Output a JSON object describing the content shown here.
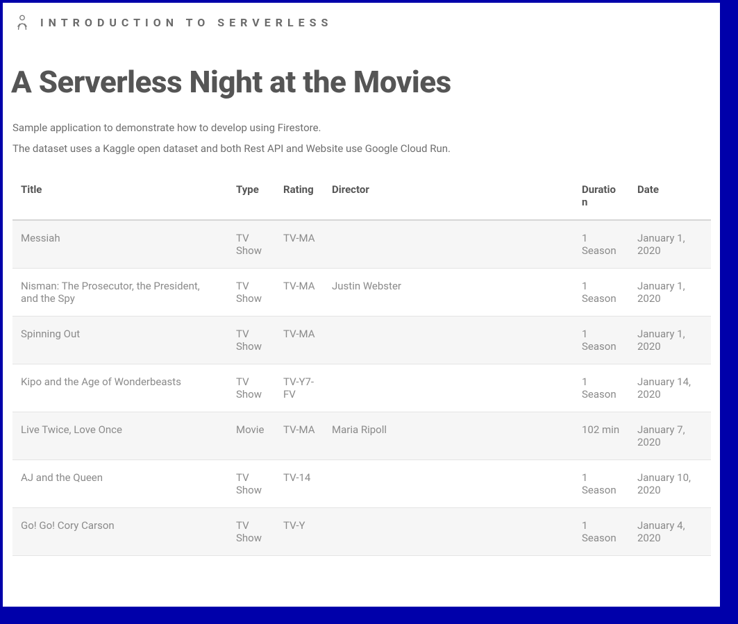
{
  "header": {
    "site_title": "INTRODUCTION TO SERVERLESS"
  },
  "main": {
    "page_title": "A Serverless Night at the Movies",
    "desc_line1": "Sample application to demonstrate how to develop using Firestore.",
    "desc_line2": "The dataset uses a Kaggle open dataset and both Rest API and Website use Google Cloud Run."
  },
  "table": {
    "headers": {
      "title": "Title",
      "type": "Type",
      "rating": "Rating",
      "director": "Director",
      "duration": "Duration",
      "date": "Date"
    },
    "rows": [
      {
        "title": "Messiah",
        "type": "TV Show",
        "rating": "TV-MA",
        "director": "",
        "duration": "1 Season",
        "date": "January 1, 2020"
      },
      {
        "title": "Nisman: The Prosecutor, the President, and the Spy",
        "type": "TV Show",
        "rating": "TV-MA",
        "director": "Justin Webster",
        "duration": "1 Season",
        "date": "January 1, 2020"
      },
      {
        "title": "Spinning Out",
        "type": "TV Show",
        "rating": "TV-MA",
        "director": "",
        "duration": "1 Season",
        "date": "January 1, 2020"
      },
      {
        "title": "Kipo and the Age of Wonderbeasts",
        "type": "TV Show",
        "rating": "TV-Y7-FV",
        "director": "",
        "duration": "1 Season",
        "date": "January 14, 2020"
      },
      {
        "title": "Live Twice, Love Once",
        "type": "Movie",
        "rating": "TV-MA",
        "director": "Maria Ripoll",
        "duration": "102 min",
        "date": "January 7, 2020"
      },
      {
        "title": "AJ and the Queen",
        "type": "TV Show",
        "rating": "TV-14",
        "director": "",
        "duration": "1 Season",
        "date": "January 10, 2020"
      },
      {
        "title": "Go! Go! Cory Carson",
        "type": "TV Show",
        "rating": "TV-Y",
        "director": "",
        "duration": "1 Season",
        "date": "January 4, 2020"
      }
    ]
  }
}
